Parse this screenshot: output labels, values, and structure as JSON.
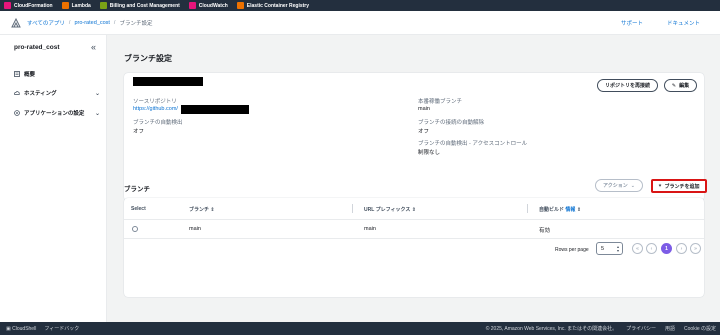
{
  "favorites": [
    {
      "label": "CloudFormation",
      "color": "#e7157b"
    },
    {
      "label": "Lambda",
      "color": "#ed7100"
    },
    {
      "label": "Billing and Cost Management",
      "color": "#7aa116"
    },
    {
      "label": "CloudWatch",
      "color": "#e7157b"
    },
    {
      "label": "Elastic Container Registry",
      "color": "#ed7100"
    }
  ],
  "breadcrumb": {
    "root": "すべてのアプリ",
    "app": "pro-rated_cost",
    "current": "ブランチ設定"
  },
  "top_links": {
    "support": "サポート",
    "docs": "ドキュメント"
  },
  "sidebar": {
    "app_name": "pro-rated_cost",
    "items": [
      {
        "label": "概要",
        "icon": "list-icon"
      },
      {
        "label": "ホスティング",
        "icon": "cloud-icon"
      },
      {
        "label": "アプリケーションの設定",
        "icon": "settings-icon"
      }
    ]
  },
  "page": {
    "title": "ブランチ設定"
  },
  "repo_card": {
    "source_repo_label": "ソースリポジトリ",
    "source_repo_value": "https://github.com/",
    "auto_detect_label": "ブランチの自動検出",
    "auto_detect_value": "オフ",
    "prod_branch_label": "本番稼働ブランチ",
    "prod_branch_value": "main",
    "auto_disconnect_label": "ブランチの接続の自動解除",
    "auto_disconnect_value": "オフ",
    "access_control_label": "ブランチの自動検出 - アクセスコントロール",
    "access_control_value": "制限なし",
    "reconnect_button": "リポジトリを再接続",
    "edit_button": "編集"
  },
  "branches": {
    "title": "ブランチ",
    "actions_button": "アクション",
    "add_button": "ブランチを追加",
    "columns": {
      "select": "Select",
      "branch": "ブランチ",
      "prefix": "URL プレフィックス",
      "auto_build": "自動ビルド",
      "info": "情報"
    },
    "rows": [
      {
        "branch": "main",
        "prefix": "main",
        "auto_build": "有効"
      }
    ],
    "pagination": {
      "rows_per_page_label": "Rows per page",
      "rows_per_page": "5",
      "current_page": "1"
    }
  },
  "footer": {
    "cloudshell": "CloudShell",
    "feedback": "フィードバック",
    "copyright": "© 2025, Amazon Web Services, Inc. またはその関連会社。",
    "privacy": "プライバシー",
    "terms": "用語",
    "cookie": "Cookie の設定"
  }
}
